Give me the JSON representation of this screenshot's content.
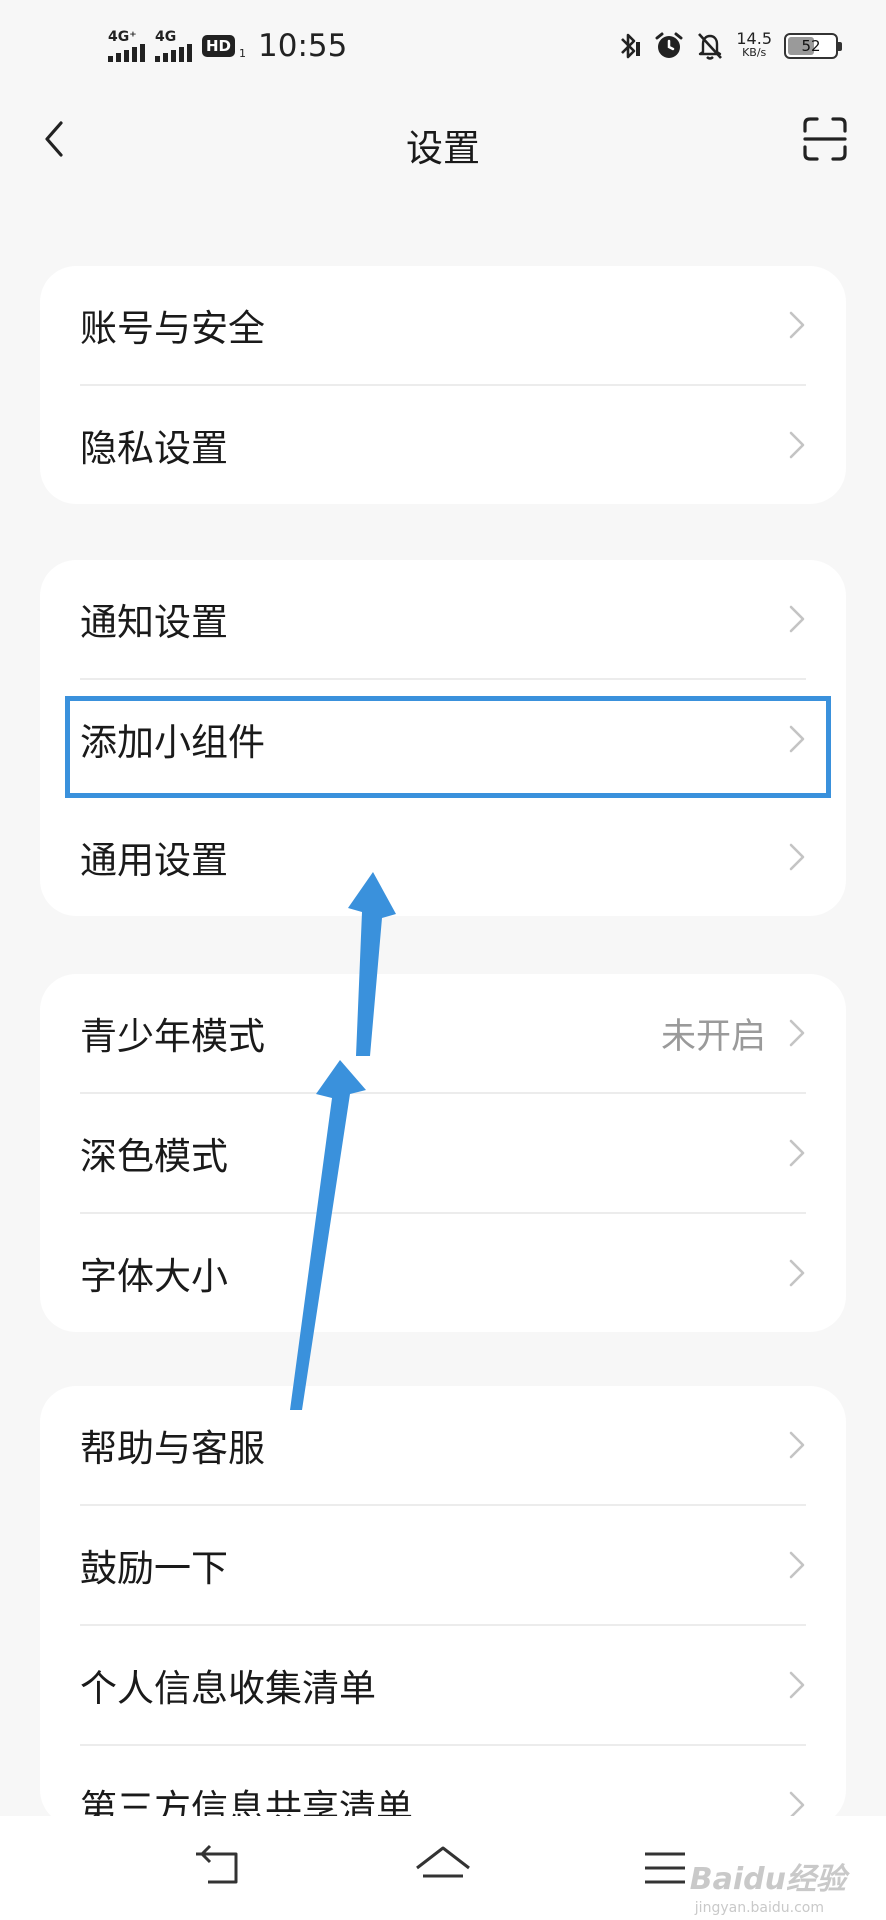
{
  "status_bar": {
    "net1": "4G⁺",
    "net2": "4G",
    "hd": "HD",
    "hd_sub": "1",
    "time": "10:55",
    "speed_value": "14.5",
    "speed_unit": "KB/s",
    "battery_level": "52",
    "icons": [
      "bluetooth-icon",
      "alarm-icon",
      "notifications-off-icon"
    ]
  },
  "header": {
    "title": "设置",
    "back_icon": "chevron-left-icon",
    "scan_icon": "scan-icon"
  },
  "groups": [
    {
      "items": [
        {
          "label": "账号与安全"
        },
        {
          "label": "隐私设置"
        }
      ]
    },
    {
      "items": [
        {
          "label": "通知设置"
        },
        {
          "label": "添加小组件"
        },
        {
          "label": "通用设置"
        }
      ]
    },
    {
      "items": [
        {
          "label": "青少年模式",
          "value": "未开启"
        },
        {
          "label": "深色模式"
        },
        {
          "label": "字体大小"
        }
      ]
    },
    {
      "items": [
        {
          "label": "帮助与客服"
        },
        {
          "label": "鼓励一下"
        },
        {
          "label": "个人信息收集清单"
        },
        {
          "label": "第三方信息共享清单"
        }
      ]
    }
  ],
  "navbar": {
    "icons": [
      "back-nav-icon",
      "home-nav-icon",
      "menu-nav-icon"
    ]
  },
  "watermark": {
    "text": "Baidu经验",
    "sub": "jingyan.baidu.com"
  },
  "colors": {
    "background": "#f7f7f7",
    "card": "#ffffff",
    "highlight": "#3a91dc",
    "arrow": "#3a91dc"
  }
}
